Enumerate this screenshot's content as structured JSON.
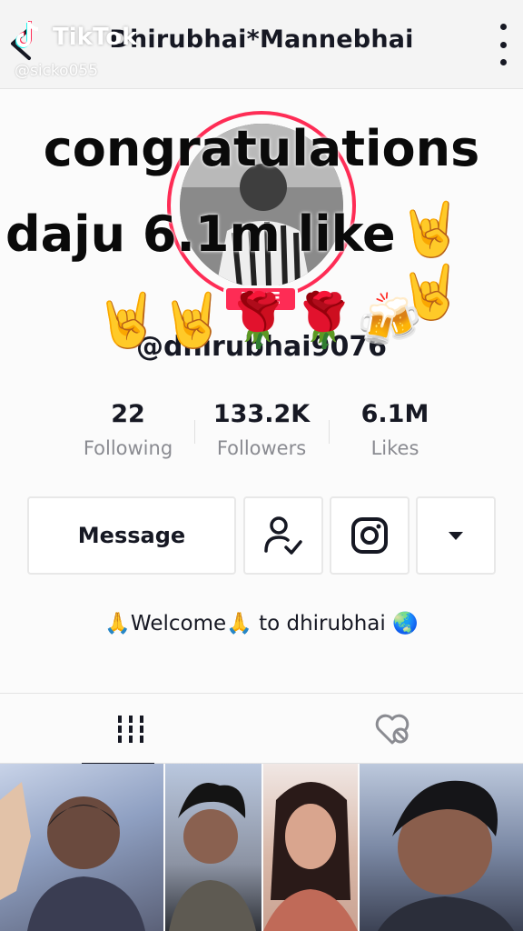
{
  "header": {
    "title": "Dhirubhai*Mannebhai"
  },
  "watermark": {
    "brand": "TikTok",
    "user": "@sicko055"
  },
  "profile": {
    "live_badge": "LIVE",
    "username": "@dhirubhai9076",
    "stats": [
      {
        "value": "22",
        "label": "Following"
      },
      {
        "value": "133.2K",
        "label": "Followers"
      },
      {
        "value": "6.1M",
        "label": "Likes"
      }
    ],
    "message_label": "Message",
    "bio": "🙏Welcome🙏 to dhirubhai 🌏"
  },
  "overlay": {
    "line1": "congratulations",
    "line2": "daju 6.1m like",
    "emojis_line2": "🤘🤘",
    "emojis_line3": "🤘🤘🌹🌹🍻"
  },
  "colors": {
    "accent": "#fe2c55",
    "text": "#161823",
    "muted": "#8a8b91"
  },
  "icons": {
    "back": "back-arrow-icon",
    "more": "more-vertical-icon",
    "friend": "user-check-icon",
    "instagram": "instagram-icon",
    "dropdown": "caret-down-icon",
    "videos_tab": "grid-icon",
    "liked_tab": "heart-hidden-icon"
  }
}
